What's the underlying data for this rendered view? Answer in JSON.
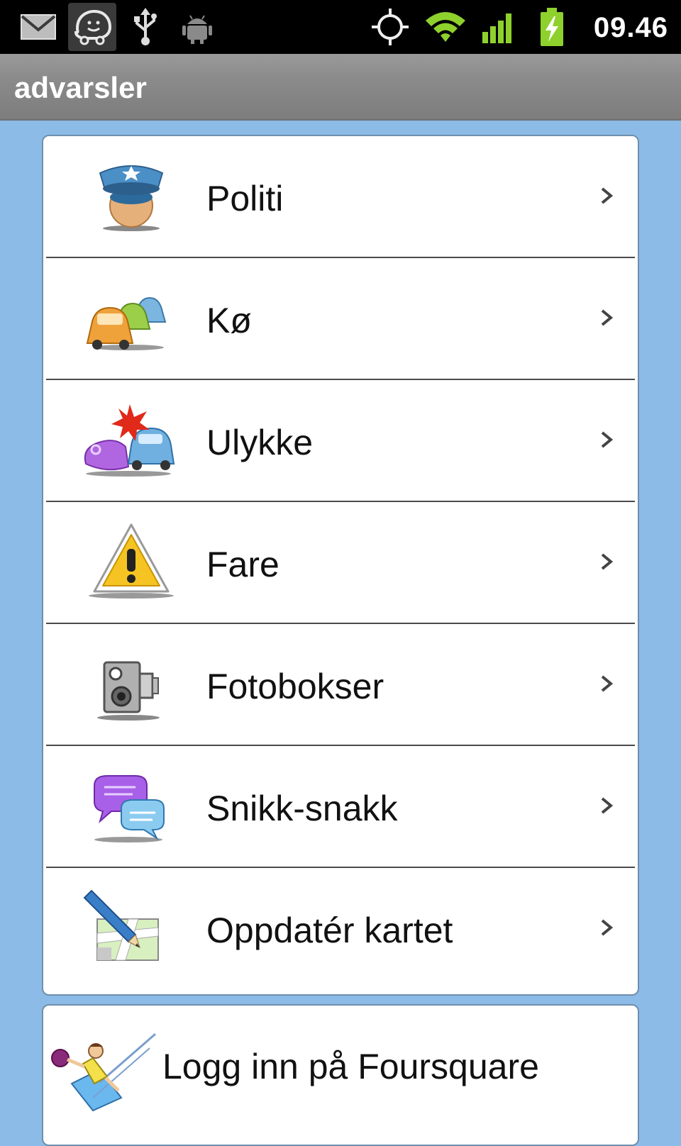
{
  "status_bar": {
    "time": "09.46",
    "left_icons": [
      "mail-icon",
      "waze-icon",
      "usb-icon",
      "android-debug-icon"
    ],
    "right_icons": [
      "gps-icon",
      "wifi-icon",
      "signal-icon",
      "battery-charging-icon"
    ]
  },
  "title_bar": {
    "title": "advarsler"
  },
  "menu": {
    "items": [
      {
        "label": "Politi",
        "icon": "police-icon"
      },
      {
        "label": "Kø",
        "icon": "traffic-jam-icon"
      },
      {
        "label": "Ulykke",
        "icon": "accident-icon"
      },
      {
        "label": "Fare",
        "icon": "hazard-icon"
      },
      {
        "label": "Fotobokser",
        "icon": "speed-camera-icon"
      },
      {
        "label": "Snikk-snakk",
        "icon": "chit-chat-icon"
      },
      {
        "label": "Oppdatér kartet",
        "icon": "map-edit-icon"
      }
    ]
  },
  "foursquare": {
    "label": "Logg inn på Foursquare",
    "icon": "foursquare-icon"
  },
  "colors": {
    "background": "#8bbbe6",
    "status_bar": "#000000",
    "title_bar": "#8a8a8a",
    "wifi": "#8fd12c",
    "battery": "#8fd12c"
  }
}
